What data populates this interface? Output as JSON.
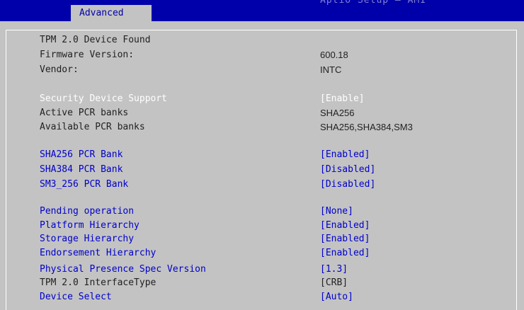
{
  "header": {
    "tab_label": "Advanced",
    "faded_title": "Aptio Setup — AMI"
  },
  "tpm": {
    "found": "TPM 2.0 Device Found",
    "firmware_label": "Firmware Version:",
    "firmware_value": "600.18",
    "vendor_label": "Vendor:",
    "vendor_value": "INTC"
  },
  "security": {
    "support_label": "Security Device Support",
    "support_value": "[Enable]",
    "active_label": "Active PCR banks",
    "active_value": "SHA256",
    "available_label": "Available PCR banks",
    "available_value": "SHA256,SHA384,SM3"
  },
  "banks": [
    {
      "label": "SHA256 PCR Bank",
      "value": "[Enabled]"
    },
    {
      "label": "SHA384 PCR Bank",
      "value": "[Disabled]"
    },
    {
      "label": "SM3_256 PCR Bank",
      "value": "[Disabled]"
    }
  ],
  "ops": [
    {
      "label": "Pending operation",
      "value": "[None]"
    },
    {
      "label": "Platform Hierarchy",
      "value": "[Enabled]"
    },
    {
      "label": "Storage Hierarchy",
      "value": "[Enabled]"
    },
    {
      "label": "Endorsement Hierarchy",
      "value": "[Enabled]"
    },
    {
      "label": "Physical Presence Spec Version",
      "value": "[1.3]"
    },
    {
      "label": "TPM 2.0 InterfaceType",
      "value": "[CRB]"
    },
    {
      "label": "Device Select",
      "value": "[Auto]"
    }
  ]
}
